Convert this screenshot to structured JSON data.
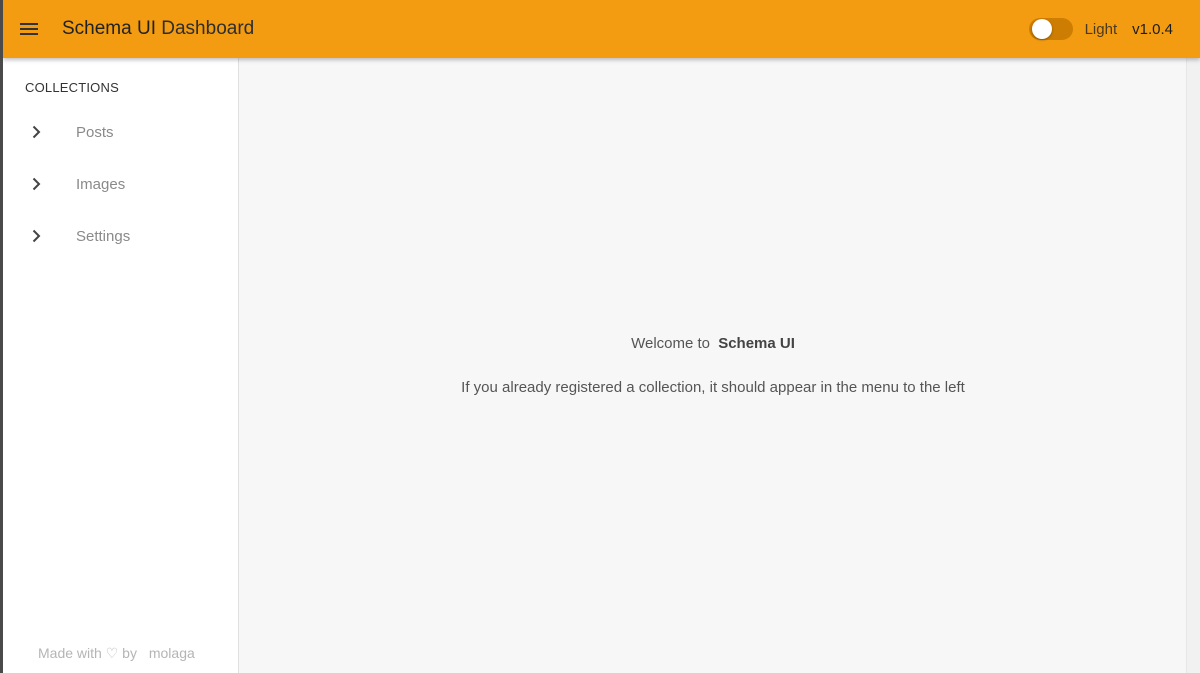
{
  "header": {
    "menu_icon": "hamburger-menu-icon",
    "title_strong": "Schema UI",
    "title_light": "Dashboard",
    "theme_label": "Light",
    "theme_toggle_on": false,
    "version": "v1.0.4",
    "accent_color": "#f39c12"
  },
  "sidebar": {
    "section_title": "COLLECTIONS",
    "items": [
      {
        "label": "Posts",
        "icon": "chevron-right-icon"
      },
      {
        "label": "Images",
        "icon": "chevron-right-icon"
      },
      {
        "label": "Settings",
        "icon": "chevron-right-icon"
      }
    ],
    "footer": {
      "made_with": "Made with",
      "heart": "♡",
      "by": "by",
      "author": "molaga"
    }
  },
  "main": {
    "welcome_prefix": "Welcome to",
    "welcome_brand": "Schema UI",
    "hint": "If you already registered a collection, it should appear in the menu to the left"
  }
}
